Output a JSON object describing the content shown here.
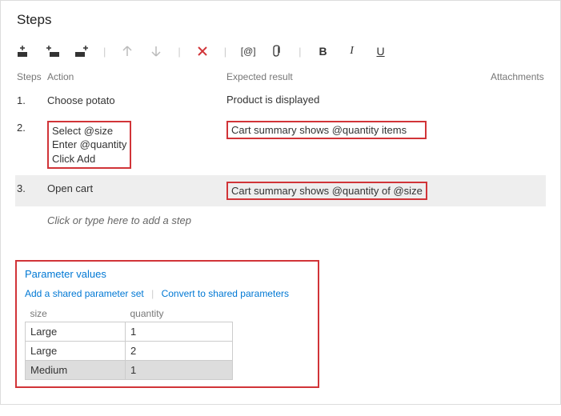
{
  "heading": "Steps",
  "columns": {
    "steps": "Steps",
    "action": "Action",
    "expected": "Expected result",
    "attachments": "Attachments"
  },
  "toolbar": {
    "at_label": "[@]"
  },
  "steps": [
    {
      "num": "1.",
      "action": "Choose potato",
      "expected": "Product is displayed",
      "action_boxed": false,
      "expected_boxed": false,
      "selected": false
    },
    {
      "num": "2.",
      "action": "Select @size\nEnter @quantity\nClick Add",
      "expected": "Cart summary shows @quantity items",
      "action_boxed": true,
      "expected_boxed": true,
      "selected": false
    },
    {
      "num": "3.",
      "action": "Open cart",
      "expected": "Cart summary shows @quantity of @size",
      "action_boxed": false,
      "expected_boxed": true,
      "selected": true
    }
  ],
  "placeholder": "Click or type here to add a step",
  "params": {
    "title": "Parameter values",
    "link_add": "Add a shared parameter set",
    "link_convert": "Convert to shared parameters",
    "headers": {
      "size": "size",
      "quantity": "quantity"
    },
    "rows": [
      {
        "size": "Large",
        "quantity": "1",
        "selected": false
      },
      {
        "size": "Large",
        "quantity": "2",
        "selected": false
      },
      {
        "size": "Medium",
        "quantity": "1",
        "selected": true
      }
    ]
  }
}
